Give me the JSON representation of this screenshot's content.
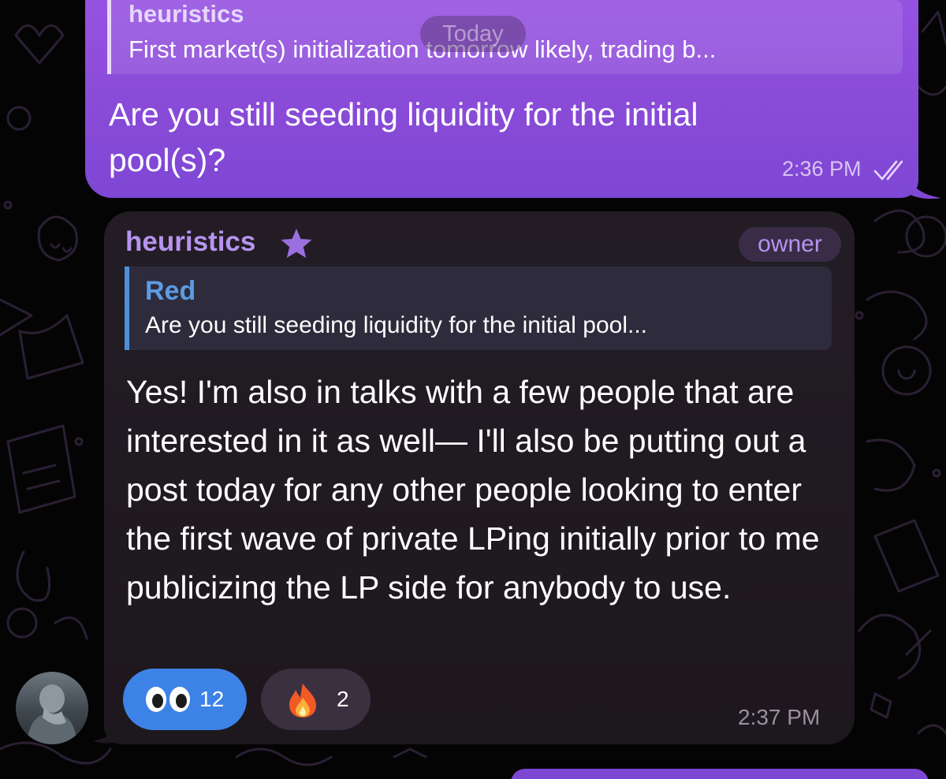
{
  "chat": {
    "date_separator": "Today",
    "outgoing": {
      "reply_name": "heuristics",
      "reply_text": "First market(s) initialization tomorrow likely, trading b...",
      "text": "Are you still seeding liquidity for the initial pool(s)?",
      "time": "2:36 PM",
      "status": "read"
    },
    "incoming": {
      "sender": "heuristics",
      "role": "owner",
      "reply_name": "Red",
      "reply_text": "Are you still seeding liquidity for the initial pool...",
      "text": "Yes! I'm also in talks with a few people that are interested in it as well— I'll also be putting out a post today for any other people looking to enter the first wave of private LPing initially prior to me publicizing the LP side for anybody to use.",
      "time": "2:37 PM",
      "reactions": [
        {
          "emoji": "eyes-icon",
          "count": "12",
          "selected": true
        },
        {
          "emoji": "fire-icon",
          "count": "2",
          "selected": false
        }
      ]
    }
  },
  "colors": {
    "outgoing_bubble": "#8a4bd8",
    "incoming_bubble": "#201a21",
    "sender_name": "#b794ef",
    "reply_accent": "#4f8fd8",
    "reaction_selected": "#3d82e6"
  }
}
